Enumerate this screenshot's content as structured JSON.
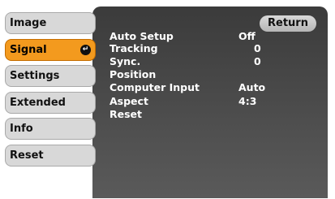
{
  "sidebar": {
    "items": [
      {
        "label": "Image"
      },
      {
        "label": "Signal"
      },
      {
        "label": "Settings"
      },
      {
        "label": "Extended"
      },
      {
        "label": "Info"
      },
      {
        "label": "Reset"
      }
    ]
  },
  "panel": {
    "return_label": "Return",
    "rows": [
      {
        "label": "Auto Setup",
        "value": "Off"
      },
      {
        "label": "Tracking",
        "value": "0"
      },
      {
        "label": "Sync.",
        "value": "0"
      },
      {
        "label": "Position",
        "value": ""
      },
      {
        "label": "Computer Input",
        "value": "Auto"
      },
      {
        "label": "Aspect",
        "value": "4:3"
      },
      {
        "label": "Reset",
        "value": ""
      }
    ]
  },
  "colors": {
    "active_tab": "#f39a1e",
    "tab": "#d8d8d8",
    "panel": "#454545"
  }
}
